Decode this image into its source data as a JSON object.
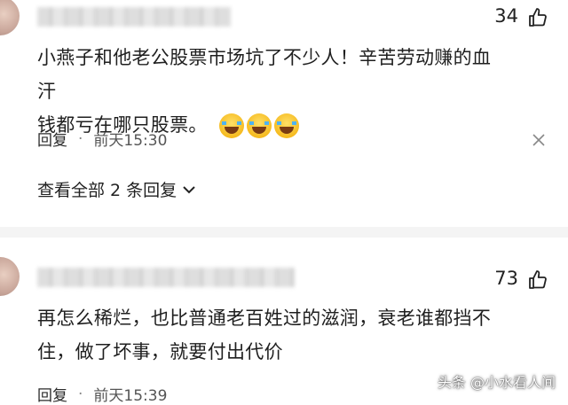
{
  "comments": [
    {
      "likes": "34",
      "text_line1": "小燕子和他老公股票市场坑了不少人！辛苦劳动赚的血汗",
      "text_line2": "钱都亏在哪只股票。",
      "reply_label": "回复",
      "separator": "·",
      "time": "前天15:30",
      "view_replies": "查看全部 2 条回复"
    },
    {
      "likes": "73",
      "text_line1": "再怎么稀烂，也比普通老百姓过的滋润，衰老谁都挡不",
      "text_line2": "住，做了坏事，就要付出代价",
      "reply_label": "回复",
      "separator": "·",
      "time": "前天15:39"
    }
  ],
  "watermark": "头条 @小水看人间",
  "icons": {
    "like": "thumbs-up-icon",
    "close": "close-icon",
    "chevron": "chevron-down-icon",
    "emoji": "laughing-crying-emoji"
  }
}
